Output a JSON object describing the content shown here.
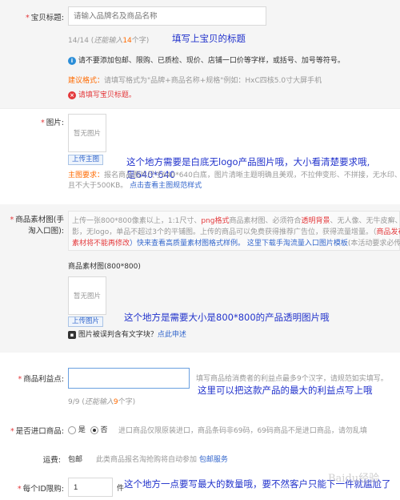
{
  "title_field": {
    "label": "宝贝标题:",
    "placeholder": "请输入品牌名及商品名称",
    "counter_prefix": "14/14 (",
    "counter_mid": "还能输入",
    "counter_num": "14",
    "counter_suffix": "个字)",
    "annotation": "填写上宝贝的标题",
    "info_text": "请不要添加包邮、限购、已质检、现价、店铺一口价等字样，或括号、加号等符号。",
    "suggestion_label": "建议格式：",
    "suggestion_text": "请填写格式为\"品牌+商品名称+规格\"例如：HxC四核5.0寸大屏手机",
    "error_text": "请填写宝贝标题。"
  },
  "image_field": {
    "label": "图片:",
    "placeholder_text": "暂无图片",
    "upload_label": "上传主图",
    "annotation": "这个地方需要是白底无logo产品图片哦，大小看清楚要求哦,",
    "annotation_size": "是640*640",
    "req_label": "主图要求：",
    "req_text": "报名商品图片尺寸640*640白底，图片清晰主题明确且美观，不拉伸变形、不拼接，无水印、",
    "req_text2": "且不大于500KB。",
    "req_link": "点击查看主图规范样式"
  },
  "material_field": {
    "label": "商品素材图(手",
    "label2": "淘入口图):",
    "hint1_a": "上传一张800*800像素以上，1:1尺寸、",
    "hint1_b": "png格式",
    "hint1_c": "商品素材图、必须符合",
    "hint1_d": "透明背景",
    "hint1_e": "、无人像、无牛皮癣、无阴",
    "hint2": "影，无logo，单品不超过3个的平铺图。上传的商品可以免费获得推荐广告位，获得流量增量。（",
    "hint2_red": "商品发布后",
    "hint3_red": "素材将不能再修改",
    "hint3_b": "）快来查看高质量素材图格式样例。",
    "hint3_link": "这里下载手淘流量入口图片模板",
    "hint3_c": "(本活动要求必传)",
    "size_label": "商品素材图(800*800)",
    "placeholder_text": "暂无图片",
    "upload_label": "上传图片",
    "annotation": "这个地方是需要大小是800*800的产品透明图片哦",
    "check_text": "图片被误判含有文字块？",
    "check_link": "点此申述"
  },
  "benefit_field": {
    "label": "商品利益点:",
    "value": "",
    "hint": "填写商品给消费者的利益点最多9个汉字，请规范如实填写。",
    "counter_prefix": "9/9 (",
    "counter_mid": "还能输入",
    "counter_num": "9",
    "counter_suffix": "个字)",
    "annotation": "这里可以把这款产品的最大的利益点写上哦"
  },
  "import_field": {
    "label": "是否进口商品:",
    "option_yes": "是",
    "option_no": "否",
    "hint": "进口商品仅限原装进口，商品条码非69码，69码商品不是进口商品，请勿乱填"
  },
  "shipping_field": {
    "label": "运费:",
    "value": "包邮",
    "hint": "此类商品报名淘抢购将自动参加",
    "link": "包邮服务"
  },
  "limit_field": {
    "label": "每个ID限购:",
    "value": "1",
    "unit": "件",
    "annotation": "这个地方一点要写最大的数量哦，要不然客户只能下一件就尴尬了"
  },
  "watermark": "Baidu经验"
}
